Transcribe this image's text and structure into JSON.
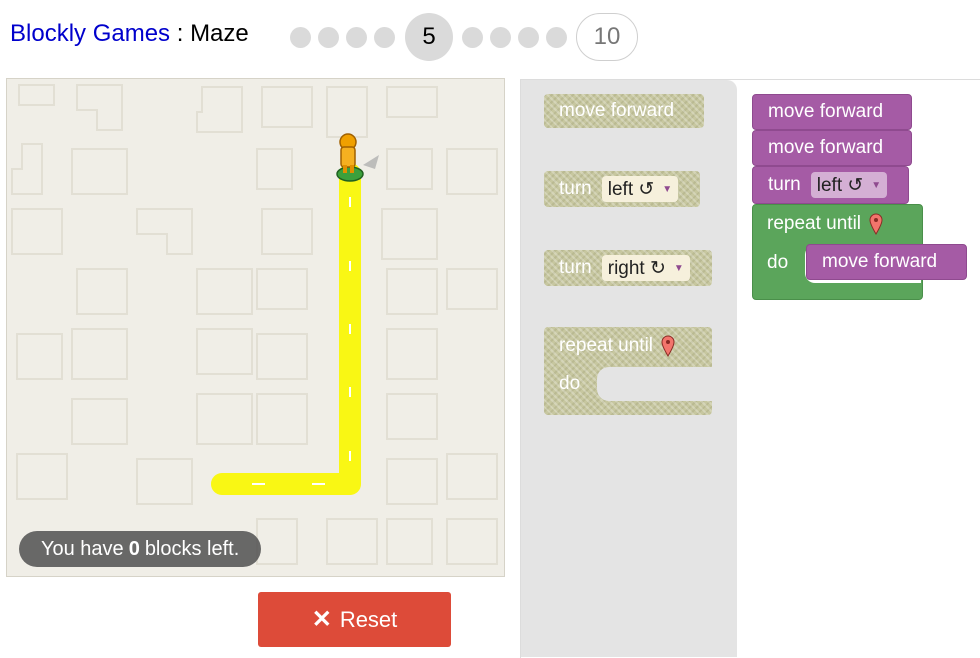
{
  "header": {
    "brand": "Blockly Games",
    "separator": " : ",
    "game": "Maze",
    "current_level": "5",
    "last_level": "10"
  },
  "maze": {
    "capacity_prefix": "You have",
    "capacity_count": "0",
    "capacity_suffix": "blocks left."
  },
  "reset": {
    "label": "Reset"
  },
  "flyout": {
    "move_forward": "move forward",
    "turn_label": "turn",
    "left_option": "left ↺",
    "right_option": "right ↻",
    "repeat_until": "repeat until",
    "do_label": "do"
  },
  "program": {
    "stmt1": "move forward",
    "stmt2": "move forward",
    "turn_label": "turn",
    "turn_option": "left ↺",
    "repeat_until": "repeat until",
    "do_label": "do",
    "inner": "move forward"
  },
  "colors": {
    "accent_reset": "#dd4b39",
    "movement_block": "#a55ba5",
    "loop_block": "#5ba55b",
    "path": "#ffff00"
  }
}
